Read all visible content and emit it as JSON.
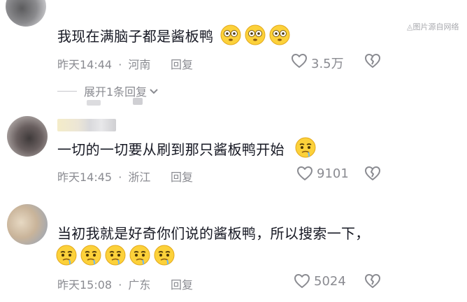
{
  "watermark": "◬图片源自网络",
  "comments": [
    {
      "text": "我现在满脑子都是酱板鸭",
      "time": "昨天14:44",
      "location": "河南",
      "reply_label": "回复",
      "likes": "3.5万",
      "expand_label": "展开1条回复",
      "emojis": [
        "flushed-emoji",
        "flushed-emoji",
        "flushed-emoji"
      ]
    },
    {
      "text": "一切的一切要从刷到那只酱板鸭开始",
      "time": "昨天14:45",
      "location": "浙江",
      "reply_label": "回复",
      "likes": "9101",
      "emojis": [
        "drooling-emoji"
      ]
    },
    {
      "text": "当初我就是好奇你们说的酱板鸭，所以搜索一下，",
      "time": "昨天15:08",
      "location": "广东",
      "reply_label": "回复",
      "likes": "5024",
      "emojis": [
        "drooling-emoji",
        "drooling-emoji",
        "drooling-emoji",
        "drooling-emoji",
        "drooling-emoji"
      ]
    }
  ],
  "separator": "·",
  "icons": {
    "like": "heart-outline-icon",
    "dislike": "broken-heart-icon",
    "expand": "chevron-down-icon"
  },
  "colors": {
    "text": "#161823",
    "meta": "#8a8b91",
    "emoji": "#fcd13a"
  }
}
